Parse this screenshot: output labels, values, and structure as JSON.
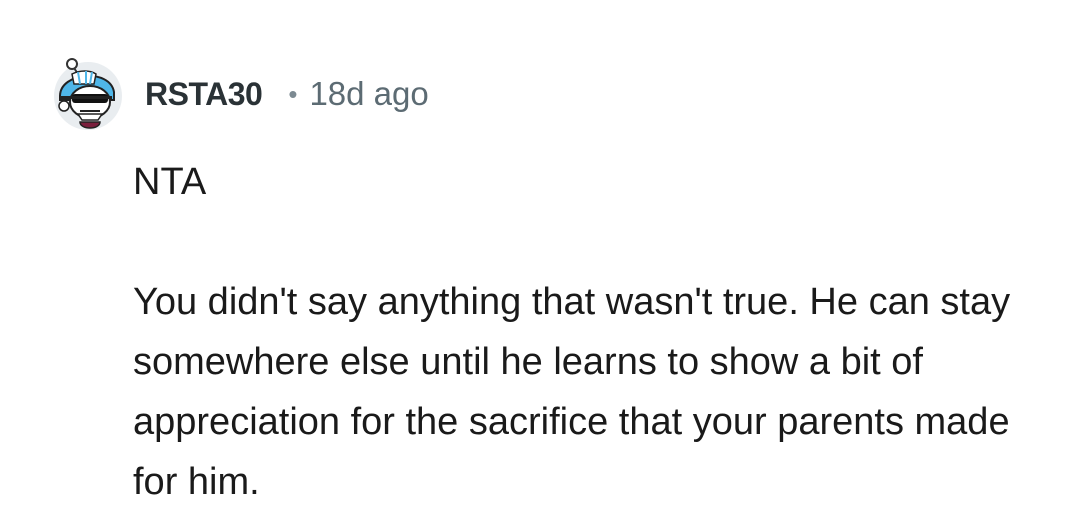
{
  "comment": {
    "username": "RSTA30",
    "separator": "•",
    "timestamp": "18d ago",
    "avatar_icon": "snoo-avatar-icon",
    "paragraphs": [
      "NTA",
      "You didn't say anything that wasn't true. He can stay somewhere else until he learns to show a bit of appreciation for the sacrifice that your parents made for him."
    ]
  }
}
